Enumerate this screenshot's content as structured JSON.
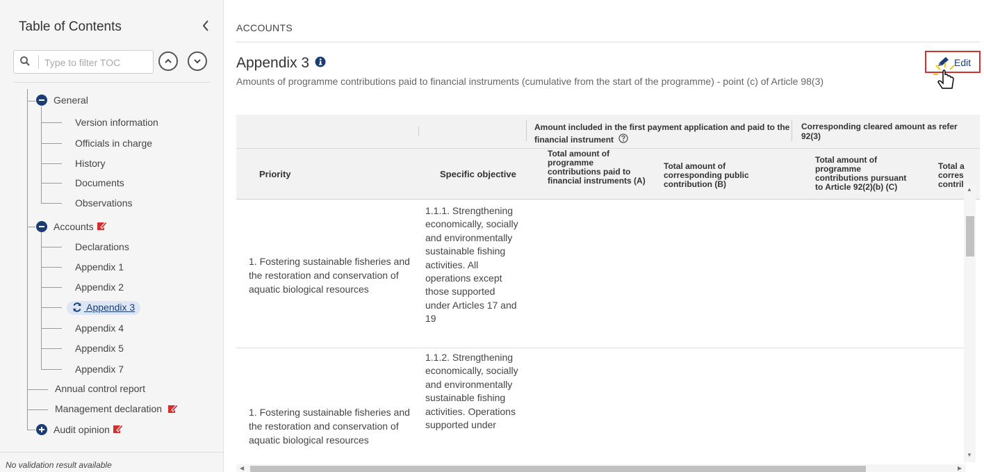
{
  "sidebar": {
    "header": "Table of Contents",
    "search_placeholder": "Type to filter TOC",
    "items": {
      "general": "General",
      "version_information": "Version information",
      "officials_in_charge": "Officials in charge",
      "history": "History",
      "documents": "Documents",
      "observations": "Observations",
      "accounts": "Accounts",
      "declarations": "Declarations",
      "appendix_1": "Appendix 1",
      "appendix_2": "Appendix 2",
      "appendix_3": "Appendix 3",
      "appendix_4": "Appendix 4",
      "appendix_5": "Appendix 5",
      "appendix_7": "Appendix 7",
      "annual_control_report": "Annual control report",
      "management_declaration": "Management declaration",
      "audit_opinion": "Audit opinion"
    },
    "validation": "No validation result available"
  },
  "main": {
    "breadcrumb": "ACCOUNTS",
    "title": "Appendix 3",
    "subtitle": "Amounts of programme contributions paid to financial instruments (cumulative from the start of the programme) - point (c) of Article 98(3)",
    "edit_label": "Edit"
  },
  "table": {
    "group_headers": {
      "first_payment": "Amount included in the first payment application and paid to the financial instrument",
      "cleared": "Corresponding cleared amount as refer",
      "cleared_line2": "92(3)"
    },
    "columns": {
      "priority": "Priority",
      "specific_objective": "Specific objective",
      "col_a": "Total amount of programme contributions paid to financial instruments (A)",
      "col_b": "Total amount of corresponding public contribution (B)",
      "col_c": "Total amount of programme contributions pursuant to Article 92(2)(b) (C)",
      "col_d_l1": "Total a",
      "col_d_l2": "corres",
      "col_d_l3": "contril"
    },
    "rows": [
      {
        "priority": "1. Fostering sustainable fisheries and the restoration and conservation of aquatic biological resources",
        "objective": "1.1.1. Strengthening economically, socially and environmentally sustainable fishing activities. All operations except those supported under Articles 17 and 19"
      },
      {
        "priority": "1. Fostering sustainable fisheries and the restoration and conservation of aquatic biological resources",
        "objective": "1.1.2. Strengthening economically, socially and environmentally sustainable fishing activities. Operations supported under"
      }
    ]
  }
}
